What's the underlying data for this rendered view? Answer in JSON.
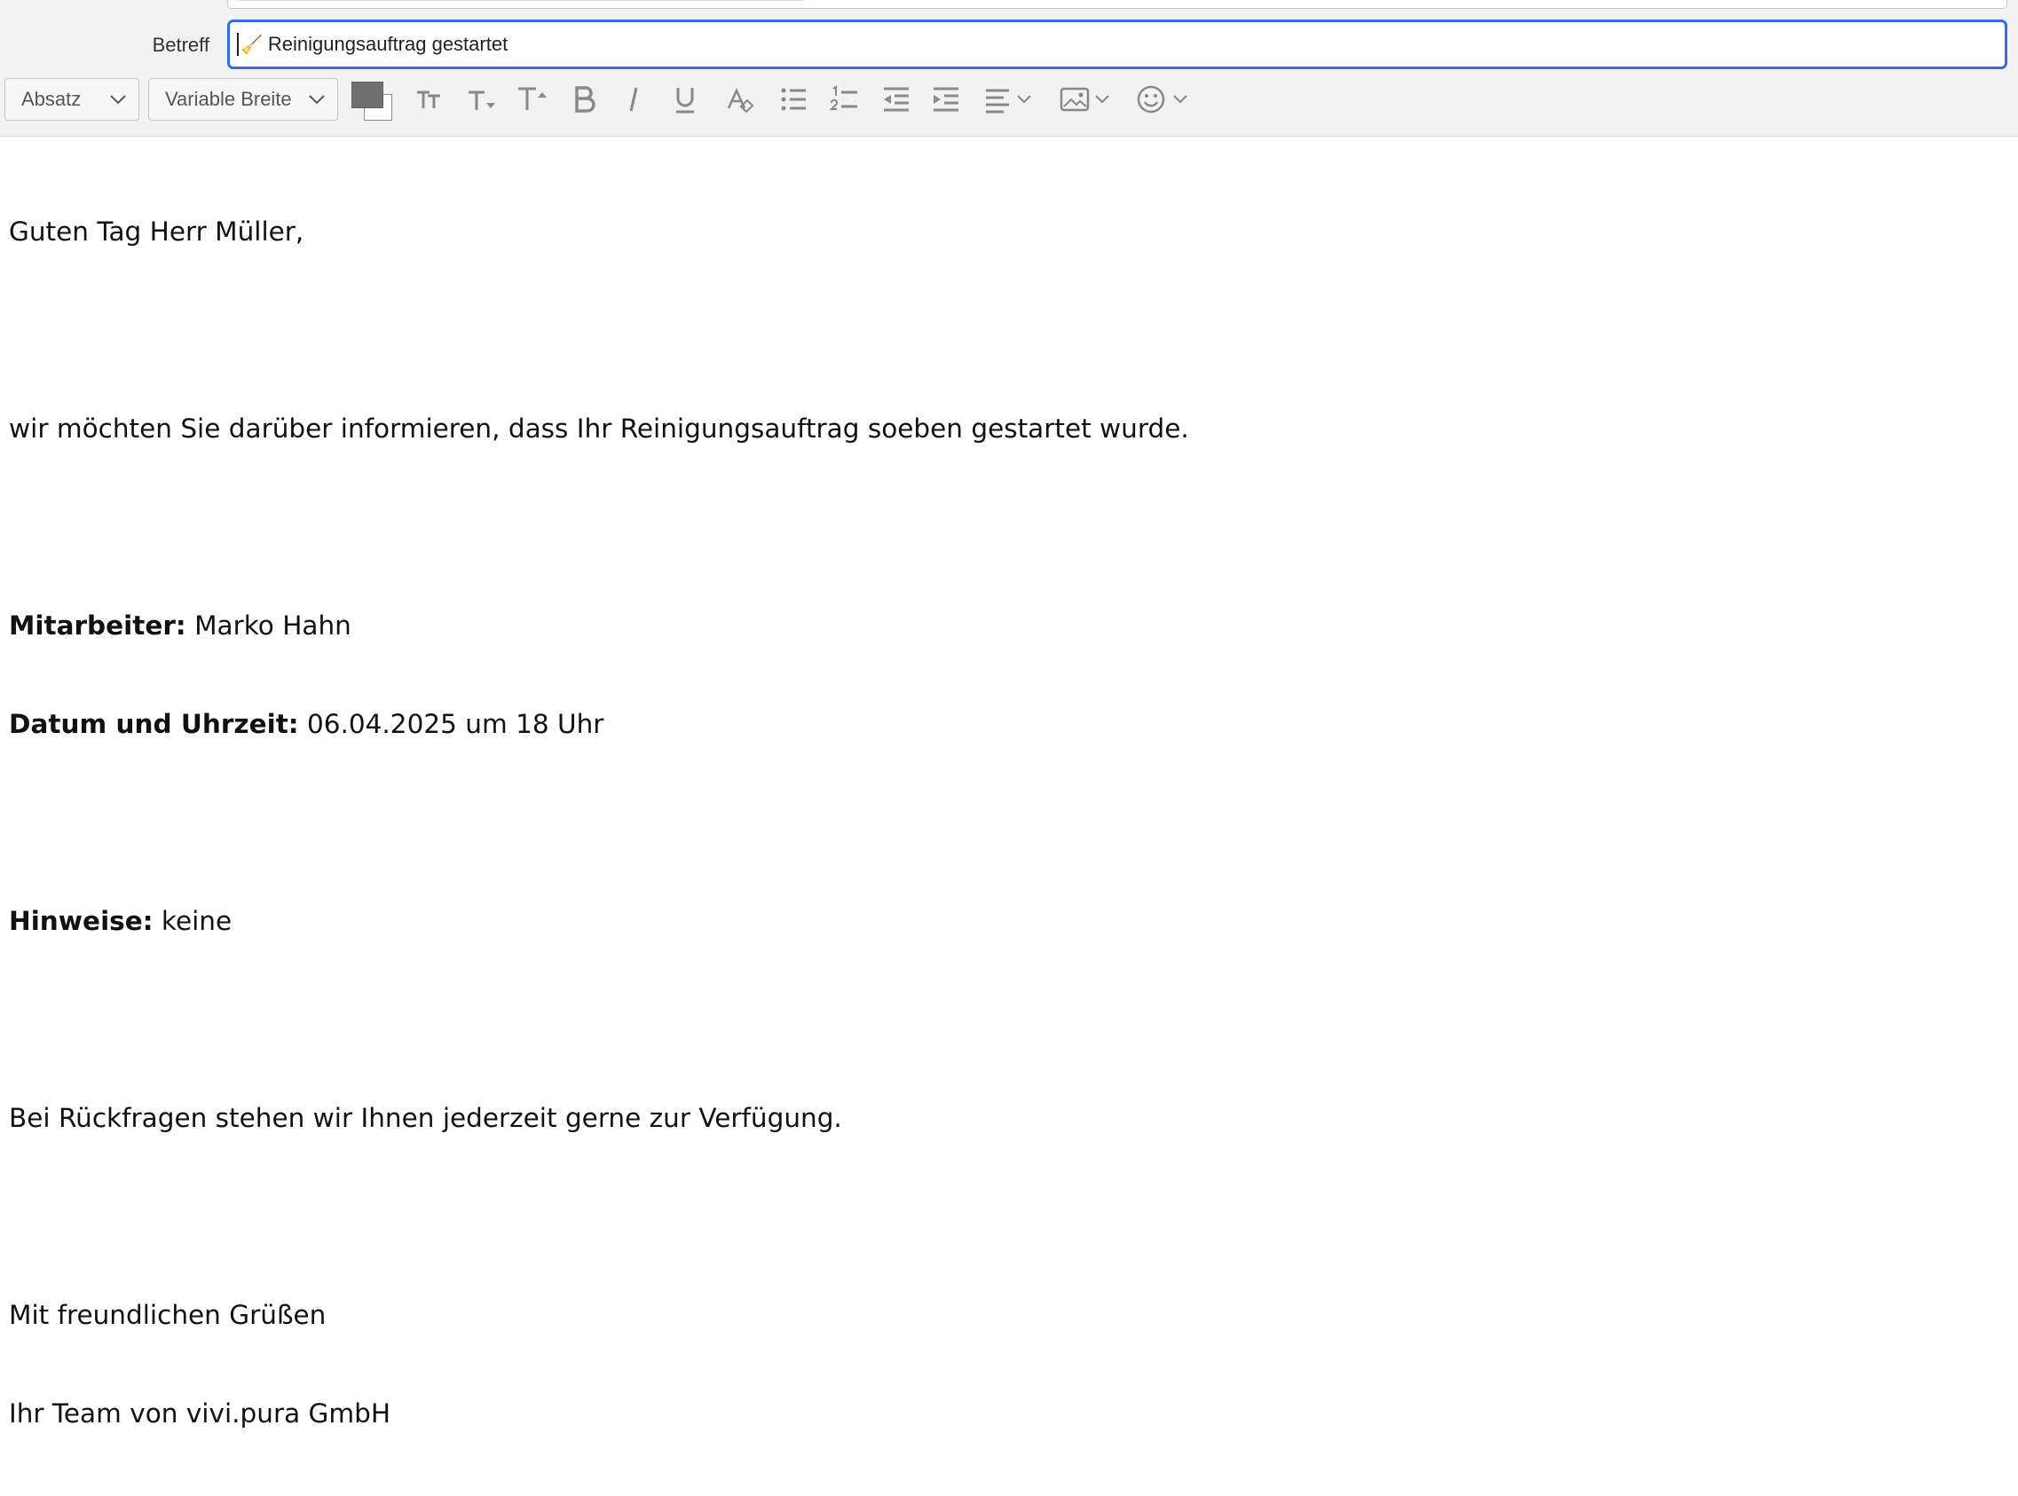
{
  "header": {
    "subject_label": "Betreff",
    "subject_icon": "broom-icon",
    "subject_value": "Reinigungsauftrag gestartet"
  },
  "toolbar": {
    "paragraph_format": "Absatz",
    "font_family": "Variable Breite",
    "colors": {
      "text_color": "#707070",
      "background_color": "#ffffff"
    },
    "buttons": [
      "smaller-text-icon",
      "text-size-down-icon",
      "text-size-up-icon",
      "bold-icon",
      "italic-icon",
      "underline-icon",
      "remove-formatting-icon",
      "bulleted-list-icon",
      "numbered-list-icon",
      "decrease-indent-icon",
      "increase-indent-icon",
      "align-icon",
      "insert-image-icon",
      "emoji-icon"
    ]
  },
  "message": {
    "greeting": "Guten Tag Herr Müller,",
    "intro": "wir möchten Sie darüber informieren, dass Ihr Reinigungsauftrag soeben gestartet wurde.",
    "employee_label": "Mitarbeiter:",
    "employee_value": " Marko Hahn",
    "datetime_label": "Datum und Uhrzeit:",
    "datetime_value": " 06.04.2025 um 18 Uhr",
    "notes_label": "Hinweise:",
    "notes_value": " keine",
    "questions": "Bei Rückfragen stehen wir Ihnen jederzeit gerne zur Verfügung.",
    "closing": "Mit freundlichen Grüßen",
    "signature": "Ihr Team von vivi.pura GmbH"
  }
}
